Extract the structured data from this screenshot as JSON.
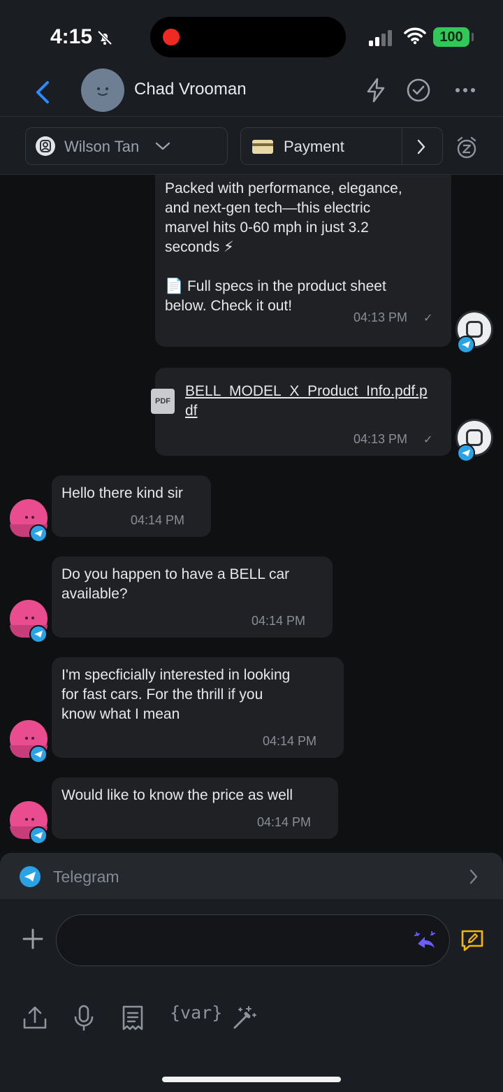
{
  "status_bar": {
    "time": "4:15",
    "battery": "100"
  },
  "header": {
    "contact_name": "Chad Vrooman"
  },
  "context": {
    "assignee": "Wilson Tan",
    "payment_label": "Payment"
  },
  "messages": {
    "m1": {
      "text": "Packed with performance, elegance,\nand next-gen tech—this electric\nmarvel hits 0-60 mph in just 3.2\nseconds ⚡\n\n📄 Full specs in the product sheet\nbelow. Check it out!",
      "time": "04:13 PM"
    },
    "m2": {
      "file_icon": "PDF",
      "file_name_line1": "BELL_MODEL_X_Product_Info.pdf.p",
      "file_name_line2": "df",
      "time": "04:13 PM"
    },
    "m3": {
      "text": "Hello there kind sir",
      "time": "04:14 PM"
    },
    "m4": {
      "text": "Do you happen to have a BELL car\navailable?",
      "time": "04:14 PM"
    },
    "m5": {
      "text": "I'm specficially interested in looking\nfor fast cars. For the thrill if you\nknow what I mean",
      "time": "04:14 PM"
    },
    "m6": {
      "text": "Would like to know the price as well",
      "time": "04:14 PM"
    }
  },
  "channel": {
    "name": "Telegram"
  },
  "composer": {
    "input_value": "",
    "placeholder": "",
    "var_label": "{var}"
  },
  "colors": {
    "accent": "#2b8cff",
    "telegram": "#2aa3e6",
    "battery": "#32c759",
    "contact_avatar": "#e94d8f"
  }
}
